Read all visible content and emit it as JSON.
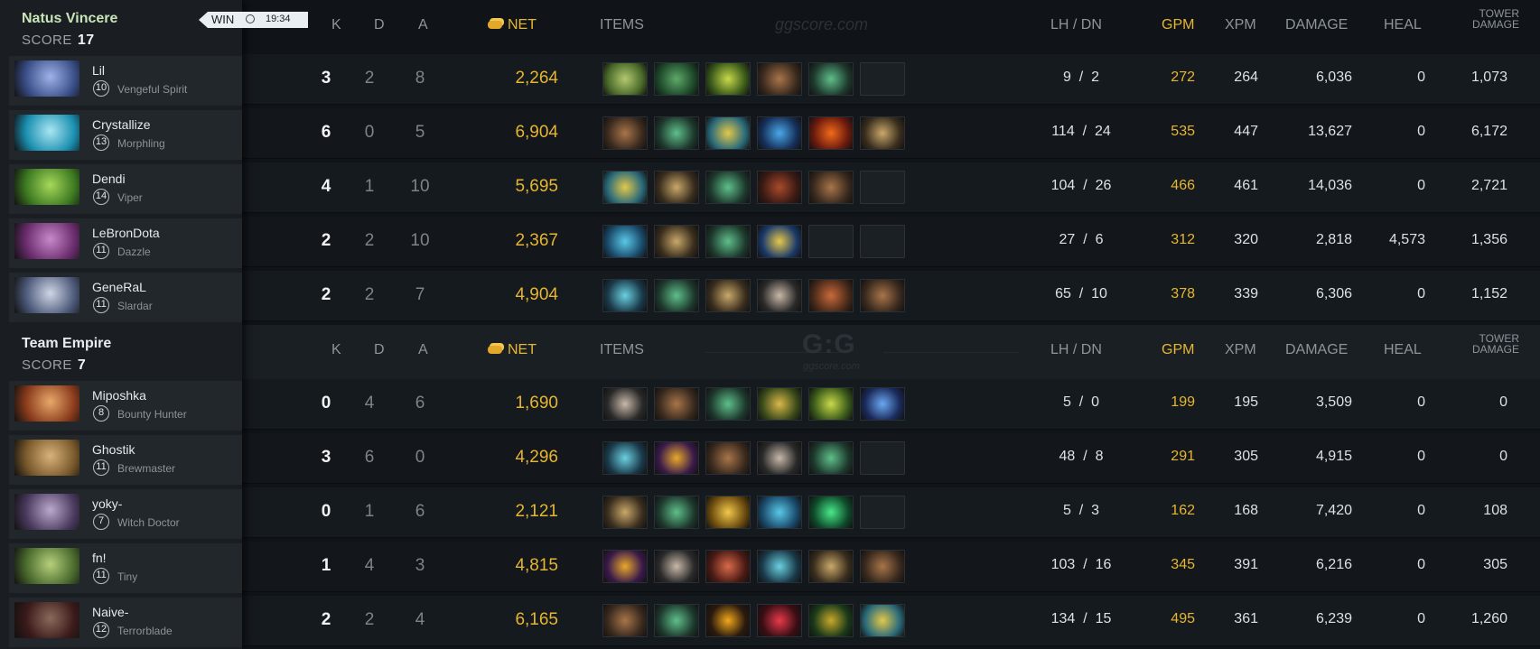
{
  "headers": {
    "k": "K",
    "d": "D",
    "a": "A",
    "net": "NET",
    "items": "ITEMS",
    "lhdn": "LH  /  DN",
    "gpm": "GPM",
    "xpm": "XPM",
    "damage": "DAMAGE",
    "heal": "HEAL",
    "tower1": "TOWER",
    "tower2": "DAMAGE"
  },
  "watermark": "ggscore.com",
  "logo": {
    "text": "G:G",
    "sub": "ggscore.com"
  },
  "match": {
    "result": "WIN",
    "time": "19:34"
  },
  "colors": {
    "gold": "#e6b632",
    "radiant_name": "#c8e5b9",
    "panel": "#1a1e22"
  },
  "teams": [
    {
      "name": "Natus Vincere",
      "score_label": "SCORE",
      "score": "17",
      "players": [
        {
          "name": "Lil",
          "level": "10",
          "hero": "Vengeful Spirit",
          "k": "3",
          "d": "2",
          "a": "8",
          "net": "2,264",
          "items": [
            "lotus-item",
            "mask-item",
            "apple-item",
            "boots-item",
            "branch-item",
            "empty"
          ],
          "lh": "9",
          "dn": "2",
          "gpm": "272",
          "xpm": "264",
          "damage": "6,036",
          "heal": "0",
          "tower": "1,073"
        },
        {
          "name": "Crystallize",
          "level": "13",
          "hero": "Morphling",
          "k": "6",
          "d": "0",
          "a": "5",
          "net": "6,904",
          "items": [
            "boots-item",
            "branch-item",
            "ring-item",
            "orb-item",
            "fire-item",
            "scroll-item"
          ],
          "lh": "114",
          "dn": "24",
          "gpm": "535",
          "xpm": "447",
          "damage": "13,627",
          "heal": "0",
          "tower": "6,172"
        },
        {
          "name": "Dendi",
          "level": "14",
          "hero": "Viper",
          "k": "4",
          "d": "1",
          "a": "10",
          "net": "5,695",
          "items": [
            "ring-item",
            "scroll-item",
            "branch-item",
            "cloak-item",
            "boots-item",
            "empty"
          ],
          "lh": "104",
          "dn": "26",
          "gpm": "466",
          "xpm": "461",
          "damage": "14,036",
          "heal": "0",
          "tower": "2,721"
        },
        {
          "name": "LeBronDota",
          "level": "11",
          "hero": "Dazzle",
          "k": "2",
          "d": "2",
          "a": "10",
          "net": "2,367",
          "items": [
            "wave-item",
            "scroll-item",
            "branch-item",
            "bottle-item",
            "empty",
            "empty"
          ],
          "lh": "27",
          "dn": "6",
          "gpm": "312",
          "xpm": "320",
          "damage": "2,818",
          "heal": "4,573",
          "tower": "1,356"
        },
        {
          "name": "GeneRaL",
          "level": "11",
          "hero": "Slardar",
          "k": "2",
          "d": "2",
          "a": "7",
          "net": "4,904",
          "items": [
            "blade-item",
            "branch-item",
            "scroll-item",
            "axe-item",
            "circlet-item",
            "boots-item"
          ],
          "lh": "65",
          "dn": "10",
          "gpm": "378",
          "xpm": "339",
          "damage": "6,306",
          "heal": "0",
          "tower": "1,152"
        }
      ]
    },
    {
      "name": "Team Empire",
      "score_label": "SCORE",
      "score": "7",
      "players": [
        {
          "name": "Miposhka",
          "level": "8",
          "hero": "Bounty Hunter",
          "k": "0",
          "d": "4",
          "a": "6",
          "net": "1,690",
          "items": [
            "axe-item",
            "boots-item",
            "branch-item",
            "ward-item",
            "apple-item",
            "potion-item"
          ],
          "lh": "5",
          "dn": "0",
          "gpm": "199",
          "xpm": "195",
          "damage": "3,509",
          "heal": "0",
          "tower": "0"
        },
        {
          "name": "Ghostik",
          "level": "11",
          "hero": "Brewmaster",
          "k": "3",
          "d": "6",
          "a": "0",
          "net": "4,296",
          "items": [
            "blade-item",
            "wand-item",
            "boots-item",
            "axe-item",
            "branch-item",
            "empty"
          ],
          "lh": "48",
          "dn": "8",
          "gpm": "291",
          "xpm": "305",
          "damage": "4,915",
          "heal": "0",
          "tower": "0"
        },
        {
          "name": "yoky-",
          "level": "7",
          "hero": "Witch Doctor",
          "k": "0",
          "d": "1",
          "a": "6",
          "net": "2,121",
          "items": [
            "scroll-item",
            "branch-item",
            "gold-item",
            "wave-item",
            "slipper-item",
            "empty"
          ],
          "lh": "5",
          "dn": "3",
          "gpm": "162",
          "xpm": "168",
          "damage": "7,420",
          "heal": "0",
          "tower": "108"
        },
        {
          "name": "fn!",
          "level": "11",
          "hero": "Tiny",
          "k": "1",
          "d": "4",
          "a": "3",
          "net": "4,815",
          "items": [
            "wand-item",
            "axe-item",
            "redaxe-item",
            "blade-item",
            "scroll-item",
            "boots-item"
          ],
          "lh": "103",
          "dn": "16",
          "gpm": "345",
          "xpm": "391",
          "damage": "6,216",
          "heal": "0",
          "tower": "305"
        },
        {
          "name": "Naive-",
          "level": "12",
          "hero": "Terrorblade",
          "k": "2",
          "d": "2",
          "a": "4",
          "net": "6,165",
          "items": [
            "boots-item",
            "branch-item",
            "sun-item",
            "claw-item",
            "dagger-item",
            "ring-item"
          ],
          "lh": "134",
          "dn": "15",
          "gpm": "495",
          "xpm": "361",
          "damage": "6,239",
          "heal": "0",
          "tower": "1,260"
        }
      ]
    }
  ]
}
